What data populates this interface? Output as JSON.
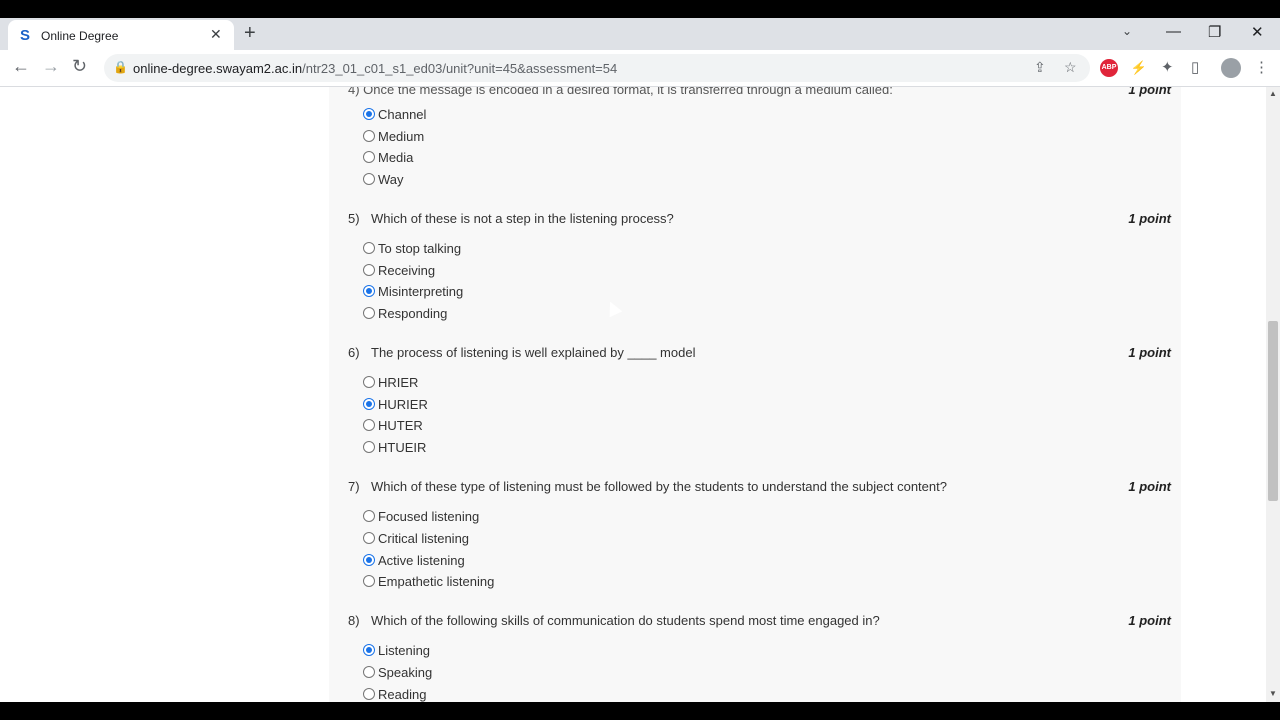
{
  "browser": {
    "tab_title": "Online Degree",
    "tab_close": "✕",
    "new_tab": "+",
    "tab_search": "⌄",
    "window_minimize": "—",
    "window_restore": "❐",
    "window_close": "✕",
    "url_host": "online-degree.swayam2.ac.in",
    "url_path": "/ntr23_01_c01_s1_ed03/unit?unit=45&assessment=54",
    "extensions": [
      "ABP",
      "⚡"
    ]
  },
  "quiz": {
    "partial_question": "4)   Once the message is encoded in a desired format, it is transferred through a medium called:",
    "partial_point": "1 point",
    "q4_options": [
      {
        "label": "Channel",
        "checked": true
      },
      {
        "label": "Medium",
        "checked": false
      },
      {
        "label": "Media",
        "checked": false
      },
      {
        "label": "Way",
        "checked": false
      }
    ],
    "questions": [
      {
        "num": "5)",
        "text": "Which of these is not a step in the listening process?",
        "point": "1 point",
        "options": [
          {
            "label": "To stop talking",
            "checked": false
          },
          {
            "label": "Receiving",
            "checked": false
          },
          {
            "label": "Misinterpreting",
            "checked": true
          },
          {
            "label": "Responding",
            "checked": false
          }
        ]
      },
      {
        "num": "6)",
        "text": "The process of listening is well explained by ____ model",
        "point": "1 point",
        "options": [
          {
            "label": "HRIER",
            "checked": false
          },
          {
            "label": "HURIER",
            "checked": true
          },
          {
            "label": "HUTER",
            "checked": false
          },
          {
            "label": "HTUEIR",
            "checked": false
          }
        ]
      },
      {
        "num": "7)",
        "text": "Which of these type of listening must be followed by the students to understand the subject content?",
        "point": "1 point",
        "options": [
          {
            "label": "Focused listening",
            "checked": false
          },
          {
            "label": "Critical listening",
            "checked": false
          },
          {
            "label": "Active listening",
            "checked": true
          },
          {
            "label": "Empathetic listening",
            "checked": false
          }
        ]
      },
      {
        "num": "8)",
        "text": "Which of the following skills of communication do students spend most time engaged in?",
        "point": "1 point",
        "options": [
          {
            "label": "Listening",
            "checked": true
          },
          {
            "label": "Speaking",
            "checked": false
          },
          {
            "label": "Reading",
            "checked": false
          }
        ]
      }
    ]
  }
}
